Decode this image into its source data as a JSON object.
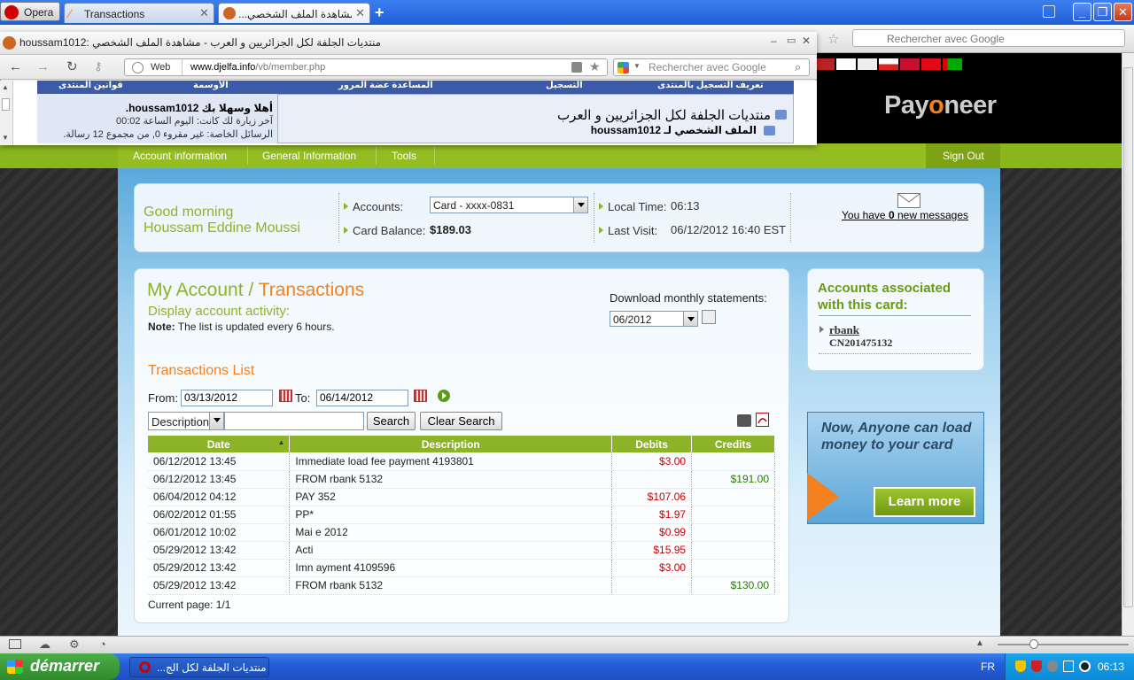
{
  "opera": {
    "menu_label": "Opera",
    "tabs": [
      {
        "label": "Transactions"
      },
      {
        "label": "...مشاهدة الملف الشخصي"
      }
    ]
  },
  "bg_search_placeholder": "Rechercher avec Google",
  "popup": {
    "title": "houssam1012: منتديات الجلفة لكل الجزائريين و العرب - مشاهدة الملف الشخصي",
    "web_label": "Web",
    "url_host": "www.djelfa.info",
    "url_path": "/vb/member.php",
    "search_placeholder": "Rechercher avec Google",
    "forum": {
      "nav": [
        "قوانين المنتدى",
        "الأوسمة",
        "التسجيل",
        "تعريف التسجيل بالمنتدى",
        "المساعدة عضة المرور"
      ],
      "welcome": "أهلا وسهلا بك houssam1012.",
      "last_visit": "آخر زيارة لك كانت: اليوم الساعة 00:02",
      "messages": "الرسائل الخاصة: غير مقروء 0, من مجموع 12 رسالة.",
      "site_title": "منتديات الجلفة لكل الجزائريين و العرب",
      "profile_title": "الملف الشخصي لـ houssam1012"
    }
  },
  "payoneer": {
    "logo": "Payoneer",
    "nav": [
      "Account information",
      "General Information",
      "Tools"
    ],
    "sign_out": "Sign Out",
    "greeting_line1": "Good morning",
    "greeting_line2": "Houssam Eddine Moussi",
    "accounts_label": "Accounts:",
    "account_selected": "Card - xxxx-0831",
    "balance_label": "Card Balance:",
    "balance_value": "$189.03",
    "local_time_label": "Local Time:",
    "local_time_value": "06:13",
    "last_visit_label": "Last Visit:",
    "last_visit_value": "06/12/2012 16:40 EST",
    "messages_prefix": "You have ",
    "messages_count": "0",
    "messages_suffix": " new messages",
    "breadcrumb_1": "My Account",
    "breadcrumb_sep": " / ",
    "breadcrumb_2": "Transactions",
    "subtitle": "Display account activity:",
    "note_label": "Note:",
    "note_text": " The list is updated every 6 hours.",
    "download_label": "Download monthly statements:",
    "download_month": "06/2012",
    "list_title": "Transactions List",
    "from_label": "From:",
    "from_value": "03/13/2012",
    "to_label": "To:",
    "to_value": "06/14/2012",
    "filter_field": "Description",
    "search_btn": "Search",
    "clear_btn": "Clear Search",
    "columns": [
      "Date",
      "Description",
      "Debits",
      "Credits"
    ],
    "rows": [
      {
        "date": "06/12/2012 13:45",
        "desc": "Immediate load fee payment 4193801",
        "debit": "$3.00",
        "credit": ""
      },
      {
        "date": "06/12/2012 13:45",
        "desc": "FROM rbank 5132",
        "debit": "",
        "credit": "$191.00"
      },
      {
        "date": "06/04/2012 04:12",
        "desc": "PAY                         352",
        "debit": "$107.06",
        "credit": ""
      },
      {
        "date": "06/02/2012 01:55",
        "desc": "PP*",
        "debit": "$1.97",
        "credit": ""
      },
      {
        "date": "06/01/2012 10:02",
        "desc": "Mai                          e 2012",
        "debit": "$0.99",
        "credit": ""
      },
      {
        "date": "05/29/2012 13:42",
        "desc": "Acti",
        "debit": "$15.95",
        "credit": ""
      },
      {
        "date": "05/29/2012 13:42",
        "desc": "Imn                          ayment 4109596",
        "debit": "$3.00",
        "credit": ""
      },
      {
        "date": "05/29/2012 13:42",
        "desc": "FROM rbank 5132",
        "debit": "",
        "credit": "$130.00"
      }
    ],
    "current_page": "Current page: 1/1",
    "assoc_title": "Accounts associated with this card:",
    "assoc_name": "rbank",
    "assoc_id": "CN201475132",
    "promo_text": "Now, Anyone can load money to your card",
    "promo_btn": "Learn more"
  },
  "taskbar": {
    "start": "démarrer",
    "task": "...منتديات الجلفة لكل الج",
    "lang": "FR",
    "clock": "06:13"
  }
}
